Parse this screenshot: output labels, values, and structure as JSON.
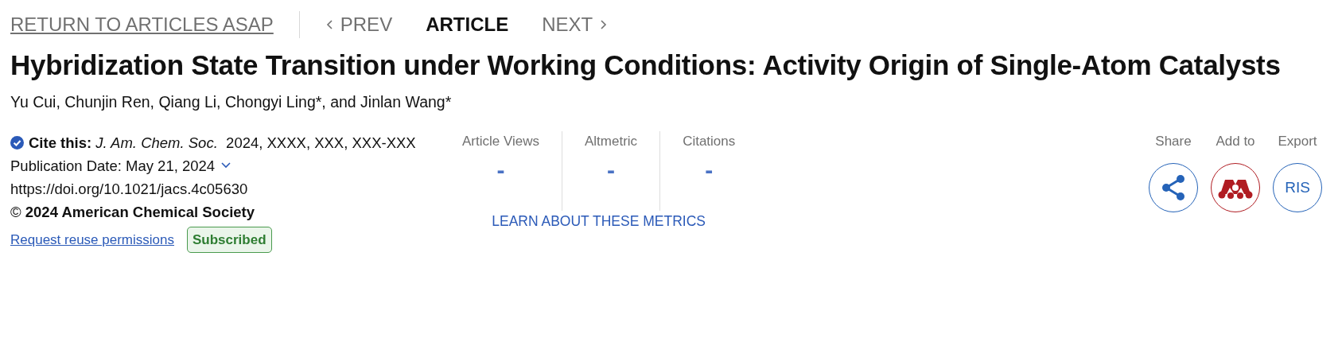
{
  "nav": {
    "return_link": "RETURN TO ARTICLES ASAP",
    "items": [
      {
        "label": "PREV",
        "kind": "prev",
        "selected": false
      },
      {
        "label": "ARTICLE",
        "kind": "current",
        "selected": true
      },
      {
        "label": "NEXT",
        "kind": "next",
        "selected": false
      }
    ]
  },
  "title": "Hybridization State Transition under Working Conditions: Activity Origin of Single-Atom Catalysts",
  "authors": "Yu Cui, Chunjin Ren, Qiang Li, Chongyi Ling*, and Jinlan Wang*",
  "citation": {
    "cite": "**Cite this:** *J. Am. Chem. Soc.*  2024, XXXX, XXX, XXX-XXX",
    "publication_date": "Publication Date: May 21, 2024",
    "doi": "https://doi.org/10.1021/jacs.4c05630",
    "copyright": "© **2024 American Chemical Society**",
    "reuse_link": "Request reuse permissions",
    "access_badge": "Subscribed"
  },
  "metrics": {
    "items": [
      {
        "label": "Article Views",
        "value": "-"
      },
      {
        "label": "Altmetric",
        "value": "-"
      },
      {
        "label": "Citations",
        "value": "-"
      }
    ],
    "learn_link": "LEARN ABOUT THESE METRICS"
  },
  "actions": [
    {
      "label": "Share",
      "kind": "share",
      "color": "#2563b8"
    },
    {
      "label": "Add to",
      "kind": "mendeley",
      "color": "#b01c22"
    },
    {
      "label": "Export",
      "kind": "text",
      "button_text": "RIS",
      "color": "#2563b8"
    }
  ]
}
